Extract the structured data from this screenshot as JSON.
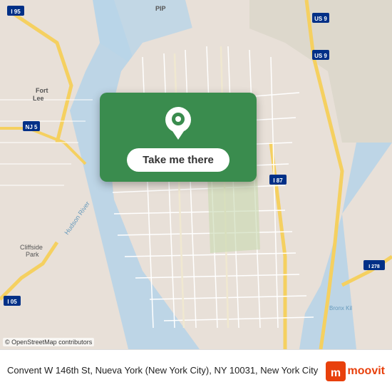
{
  "map": {
    "attribution": "© OpenStreetMap contributors"
  },
  "card": {
    "button_label": "Take me there"
  },
  "bottom_bar": {
    "address": "Convent W 146th St, Nueva York (New York City), NY 10031, New York City",
    "moovit_label": "moovit"
  }
}
